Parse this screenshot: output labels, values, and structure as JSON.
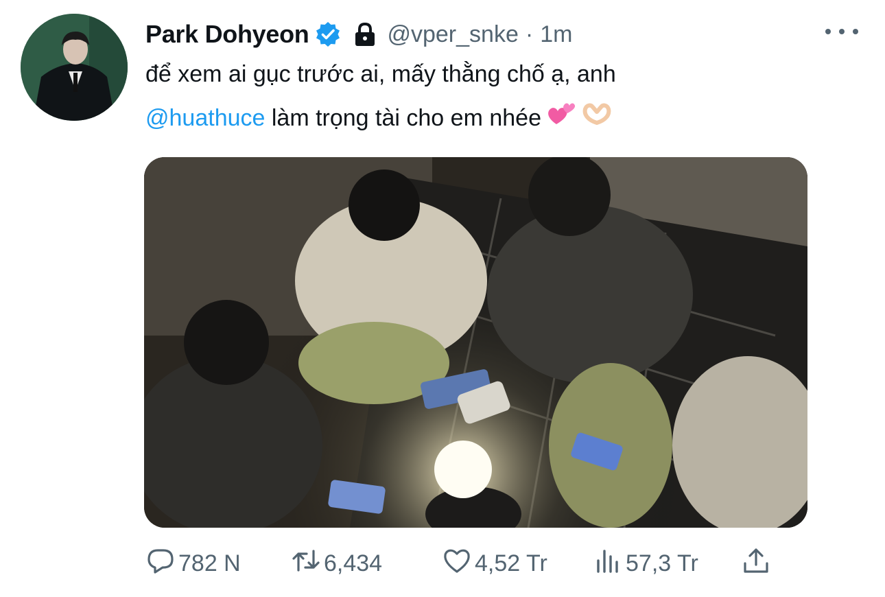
{
  "tweet": {
    "author_name": "Park Dohyeon",
    "handle": "@vper_snke",
    "separator": "·",
    "time": "1m",
    "text_line1": "để xem ai gục trước ai, mấy thằng chố ạ, anh",
    "mention": "@huathuce",
    "text_line2_rest": " làm trọng tài cho em nhée",
    "emoji_1": "hearts-emoji",
    "emoji_2": "heart-hands-emoji"
  },
  "icons": {
    "verified": "verified-badge-icon",
    "lock": "lock-icon",
    "more": "more-icon"
  },
  "actions": {
    "replies": "782 N",
    "retweets": "6,434",
    "likes": "4,52 Tr",
    "views": "57,3 Tr"
  },
  "colors": {
    "accent": "#1d9bf0",
    "muted": "#536471",
    "text": "#0f1419"
  }
}
